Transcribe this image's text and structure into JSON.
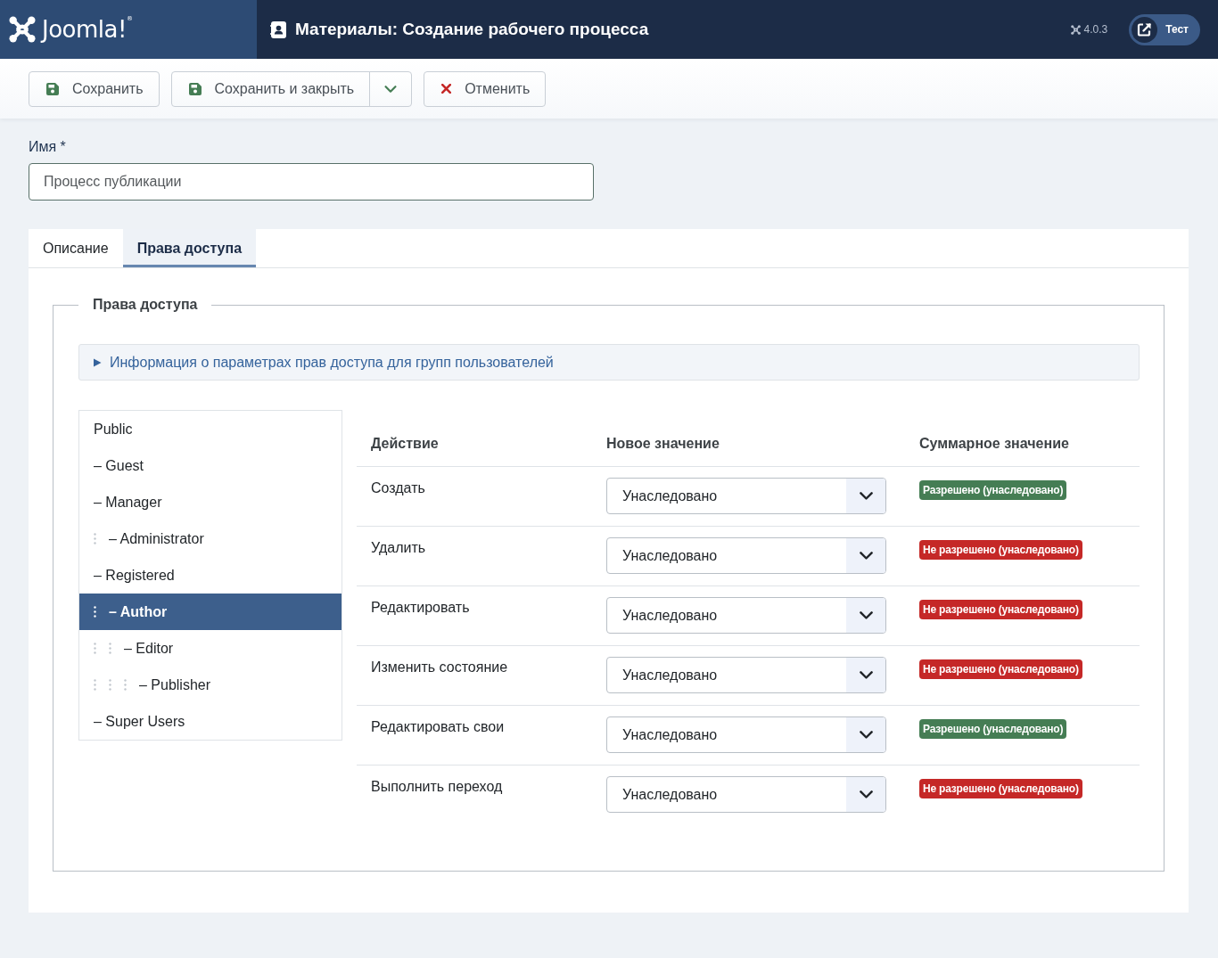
{
  "header": {
    "logo": "Joomla!$^{®}$",
    "title": "Материалы: Создание рабочего процесса",
    "version": "4.0.3",
    "user_button": "Тест"
  },
  "toolbar": [
    {
      "kind": "save",
      "label": "Сохранить",
      "has_menu": false
    },
    {
      "kind": "save",
      "label": "Сохранить и закрыть",
      "has_menu": true
    },
    {
      "kind": "cancel",
      "label": "Отменить",
      "has_menu": false
    }
  ],
  "name_field": {
    "label": "Имя *",
    "value": "Процесс публикации"
  },
  "tabs": [
    {
      "label": "Описание",
      "selected": false
    },
    {
      "label": "Права доступа",
      "selected": true
    }
  ],
  "permissions": {
    "legend": "Права доступа",
    "info": {
      "text": "Информация о параметрах прав доступа для групп пользователей",
      "expanded": false
    },
    "groups": [
      {
        "label": "Public",
        "selected": false,
        "children": [
          {
            "label": "– Guest",
            "selected": false
          },
          {
            "label": "– Manager",
            "selected": false,
            "children": [
              {
                "label": "– Administrator",
                "selected": false
              }
            ]
          },
          {
            "label": "– Registered",
            "selected": false,
            "children": [
              {
                "label": "– Author",
                "selected": true,
                "children": [
                  {
                    "label": "– Editor",
                    "selected": false,
                    "children": [
                      {
                        "label": "– Publisher",
                        "selected": false
                      }
                    ]
                  }
                ]
              }
            ]
          },
          {
            "label": "– Super Users",
            "selected": false
          }
        ]
      }
    ],
    "columns": [
      "Действие",
      "Новое значение",
      "Суммарное значение"
    ],
    "rows": [
      {
        "action": "Создать",
        "value": "Унаследовано",
        "result": "Разрешено (унаследовано)",
        "allowed": true
      },
      {
        "action": "Удалить",
        "value": "Унаследовано",
        "result": "Не разрешено (унаследовано)",
        "allowed": false
      },
      {
        "action": "Редактировать",
        "value": "Унаследовано",
        "result": "Не разрешено (унаследовано)",
        "allowed": false
      },
      {
        "action": "Изменить состояние",
        "value": "Унаследовано",
        "result": "Не разрешено (унаследовано)",
        "allowed": false
      },
      {
        "action": "Редактировать свои",
        "value": "Унаследовано",
        "result": "Разрешено (унаследовано)",
        "allowed": true
      },
      {
        "action": "Выполнить переход",
        "value": "Унаследовано",
        "result": "Не разрешено (унаследовано)",
        "allowed": false
      }
    ]
  }
}
